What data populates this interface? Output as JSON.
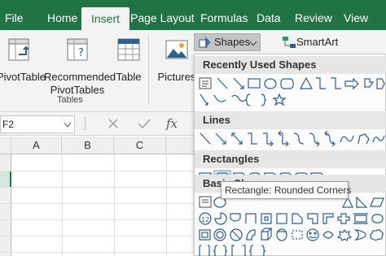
{
  "ribbon_tabs": [
    {
      "label": "File"
    },
    {
      "label": "Home"
    },
    {
      "label": "Insert"
    },
    {
      "label": "Page Layout"
    },
    {
      "label": "Formulas"
    },
    {
      "label": "Data"
    },
    {
      "label": "Review"
    },
    {
      "label": "View"
    }
  ],
  "active_tab": "Insert",
  "ribbon": {
    "pivottable_label": "PivotTable",
    "recommended_line1": "Recommended",
    "recommended_line2": "PivotTables",
    "table_label": "Table",
    "tables_group_label": "Tables",
    "pictures_label": "Pictures",
    "shapes_label": "Shapes",
    "smartart_label": "SmartArt"
  },
  "formula_bar": {
    "name_box_value": "F2",
    "cancel_icon": "cancel-x-icon",
    "enter_icon": "checkmark-icon",
    "function_label": "fx"
  },
  "grid": {
    "column_headers": [
      "A",
      "B",
      "C"
    ]
  },
  "shapes_menu": {
    "sections": {
      "recently_used": "Recently Used Shapes",
      "lines": "Lines",
      "rectangles": "Rectangles",
      "basic_shapes": "Basic Shapes"
    },
    "tooltip": "Rectangle: Rounded Corners"
  },
  "colors": {
    "excel_green": "#217346",
    "ribbon_bg": "#f3f3f3",
    "section_header_bg": "#e6e6e6",
    "shape_blue": "#2e5e8e"
  }
}
